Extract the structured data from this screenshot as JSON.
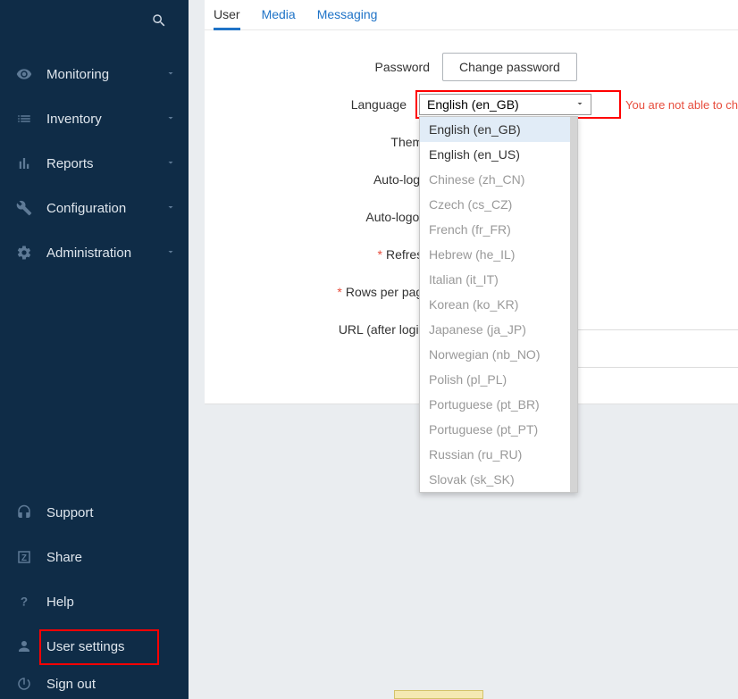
{
  "sidebar": {
    "nav": [
      {
        "label": "Monitoring"
      },
      {
        "label": "Inventory"
      },
      {
        "label": "Reports"
      },
      {
        "label": "Configuration"
      },
      {
        "label": "Administration"
      }
    ],
    "footer": {
      "support": "Support",
      "share": "Share",
      "help": "Help",
      "user_settings": "User settings",
      "sign_out": "Sign out"
    }
  },
  "tabs": {
    "user": "User",
    "media": "Media",
    "messaging": "Messaging"
  },
  "form": {
    "password_label": "Password",
    "password_button": "Change password",
    "language_label": "Language",
    "language_value": "English (en_GB)",
    "language_warning": "You are not able to ch",
    "theme_label": "Theme",
    "autologin_label": "Auto-login",
    "autologout_label": "Auto-logout",
    "refresh_label": "Refresh",
    "rows_label": "Rows per page",
    "url_label": "URL (after login)"
  },
  "language_options": [
    {
      "label": "English (en_GB)",
      "enabled": true,
      "selected": true
    },
    {
      "label": "English (en_US)",
      "enabled": true
    },
    {
      "label": "Chinese (zh_CN)",
      "enabled": false
    },
    {
      "label": "Czech (cs_CZ)",
      "enabled": false
    },
    {
      "label": "French (fr_FR)",
      "enabled": false
    },
    {
      "label": "Hebrew (he_IL)",
      "enabled": false
    },
    {
      "label": "Italian (it_IT)",
      "enabled": false
    },
    {
      "label": "Korean (ko_KR)",
      "enabled": false
    },
    {
      "label": "Japanese (ja_JP)",
      "enabled": false
    },
    {
      "label": "Norwegian (nb_NO)",
      "enabled": false
    },
    {
      "label": "Polish (pl_PL)",
      "enabled": false
    },
    {
      "label": "Portuguese (pt_BR)",
      "enabled": false
    },
    {
      "label": "Portuguese (pt_PT)",
      "enabled": false
    },
    {
      "label": "Russian (ru_RU)",
      "enabled": false
    },
    {
      "label": "Slovak (sk_SK)",
      "enabled": false
    }
  ]
}
